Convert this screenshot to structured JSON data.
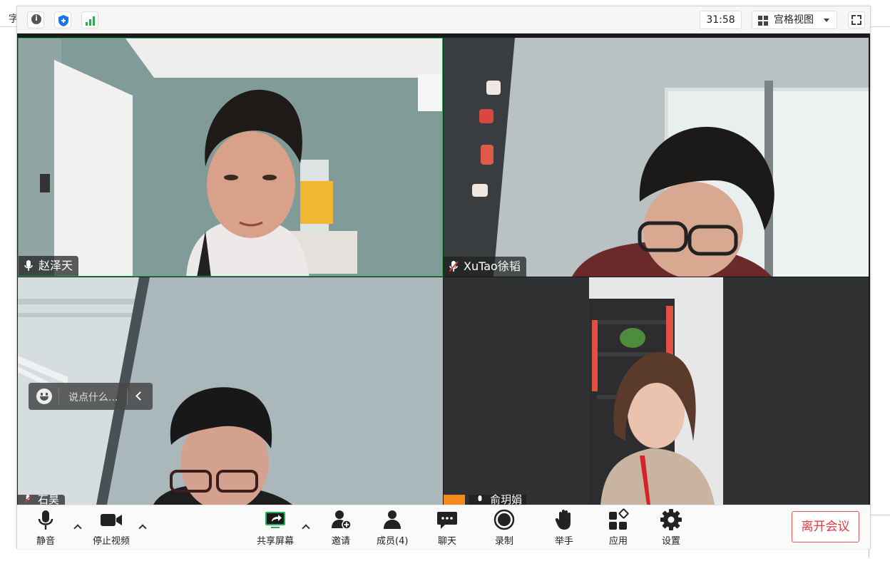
{
  "background": {
    "partial_char": "字"
  },
  "topbar": {
    "timer": "31:58",
    "layout_label": "宫格视图"
  },
  "participants": [
    {
      "name": "赵泽天",
      "muted": false,
      "active_speaker": true
    },
    {
      "name": "XuTao徐韬",
      "muted": true,
      "active_speaker": false
    },
    {
      "name": "石昊",
      "muted": true,
      "active_speaker": false
    },
    {
      "name": "俞玥娟",
      "muted": false,
      "active_speaker": false
    }
  ],
  "chat_input": {
    "placeholder": "说点什么..."
  },
  "toolbar": {
    "mute": "静音",
    "stop_video": "停止视频",
    "share_screen": "共享屏幕",
    "invite": "邀请",
    "members": "成员(4)",
    "chat": "聊天",
    "record": "录制",
    "raise_hand": "举手",
    "apps": "应用",
    "settings": "设置",
    "leave": "离开会议"
  },
  "colors": {
    "active_speaker_border": "#1fb25a",
    "leave_red": "#e0393e",
    "share_green": "#1fb25a",
    "shield_blue": "#1a73e8",
    "signal_green": "#22b04b"
  }
}
